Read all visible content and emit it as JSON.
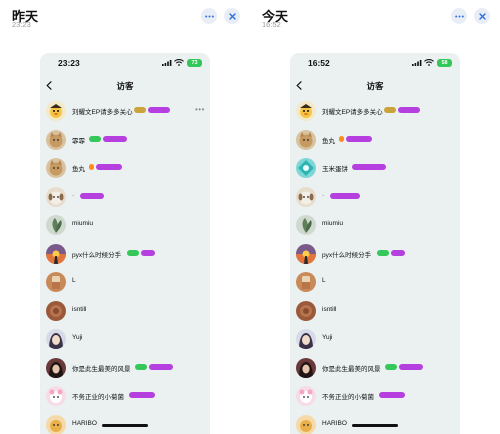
{
  "left": {
    "heading": "昨天",
    "time": "23:23",
    "status_time": "23:23",
    "battery": "73",
    "title": "访客",
    "visitors": [
      {
        "name": "刘耀文EP请多多关心",
        "avatar": "cartoon-duck"
      },
      {
        "name": "霏霏",
        "avatar": "cat"
      },
      {
        "name": "鱼丸",
        "avatar": "cat"
      },
      {
        "name": "·",
        "avatar": "puppy"
      },
      {
        "name": "miumiu",
        "avatar": "plant"
      },
      {
        "name": "pyx什么时候分手",
        "avatar": "sunset"
      },
      {
        "name": "L",
        "avatar": "drink"
      },
      {
        "name": "isntill",
        "avatar": "wood"
      },
      {
        "name": "Yuji",
        "avatar": "anime"
      },
      {
        "name": "你是此生最美的风景",
        "avatar": "portrait"
      },
      {
        "name": "不务正业的小菊菌",
        "avatar": "cartoon-pink"
      },
      {
        "name": "HARIBO",
        "avatar": "candy"
      }
    ]
  },
  "right": {
    "heading": "今天",
    "time": "16:52",
    "status_time": "16:52",
    "battery": "58",
    "title": "访客",
    "visitors": [
      {
        "name": "刘耀文EP请多多关心",
        "avatar": "cartoon-duck"
      },
      {
        "name": "鱼丸",
        "avatar": "cat"
      },
      {
        "name": "玉米蛋饼",
        "avatar": "teal"
      },
      {
        "name": "·",
        "avatar": "puppy"
      },
      {
        "name": "miumiu",
        "avatar": "plant"
      },
      {
        "name": "pyx什么时候分手",
        "avatar": "sunset"
      },
      {
        "name": "L",
        "avatar": "drink"
      },
      {
        "name": "isntill",
        "avatar": "wood"
      },
      {
        "name": "Yuji",
        "avatar": "anime"
      },
      {
        "name": "你是此生最美的风景",
        "avatar": "portrait"
      },
      {
        "name": "不务正业的小菊菌",
        "avatar": "cartoon-pink"
      },
      {
        "name": "HARIBO",
        "avatar": "candy"
      }
    ]
  },
  "colors": {
    "accent_blue": "#2c6fdc",
    "badge_purple": "#b63fe0",
    "badge_green": "#34c759",
    "badge_orange": "#ff8a1c",
    "phone_bg": "#ebf1f1"
  },
  "icons": [
    "more-icon",
    "close-icon",
    "back-chevron-icon",
    "signal-icon",
    "wifi-icon",
    "battery-icon"
  ]
}
